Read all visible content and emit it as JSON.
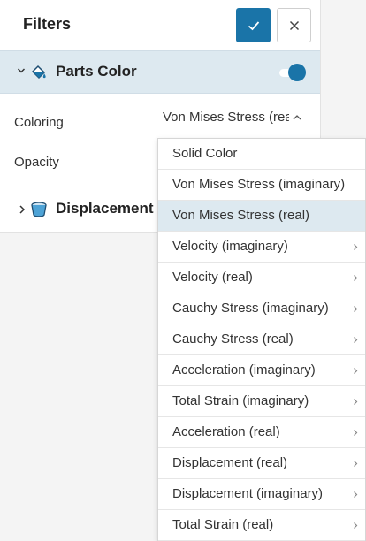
{
  "panel": {
    "title": "Filters",
    "confirm_icon": "check-icon",
    "close_icon": "close-icon"
  },
  "section_parts_color": {
    "title": "Parts Color",
    "icon": "paint-bucket-icon",
    "enabled": true,
    "coloring_label": "Coloring",
    "coloring_value": "Von Mises Stress (real)",
    "opacity_label": "Opacity"
  },
  "section_displacement": {
    "title": "Displacement",
    "icon": "tube-icon"
  },
  "dropdown": {
    "selected_index": 2,
    "items": [
      {
        "label": "Solid Color",
        "has_submenu": false
      },
      {
        "label": "Von Mises Stress (imaginary)",
        "has_submenu": false
      },
      {
        "label": "Von Mises Stress (real)",
        "has_submenu": false
      },
      {
        "label": "Velocity (imaginary)",
        "has_submenu": true
      },
      {
        "label": "Velocity (real)",
        "has_submenu": true
      },
      {
        "label": "Cauchy Stress (imaginary)",
        "has_submenu": true
      },
      {
        "label": "Cauchy Stress (real)",
        "has_submenu": true
      },
      {
        "label": "Acceleration (imaginary)",
        "has_submenu": true
      },
      {
        "label": "Total Strain (imaginary)",
        "has_submenu": true
      },
      {
        "label": "Acceleration (real)",
        "has_submenu": true
      },
      {
        "label": "Displacement (real)",
        "has_submenu": true
      },
      {
        "label": "Displacement (imaginary)",
        "has_submenu": true
      },
      {
        "label": "Total Strain (real)",
        "has_submenu": true
      }
    ]
  },
  "colors": {
    "accent": "#1a74a8",
    "selected_bg": "#dde9f0"
  }
}
